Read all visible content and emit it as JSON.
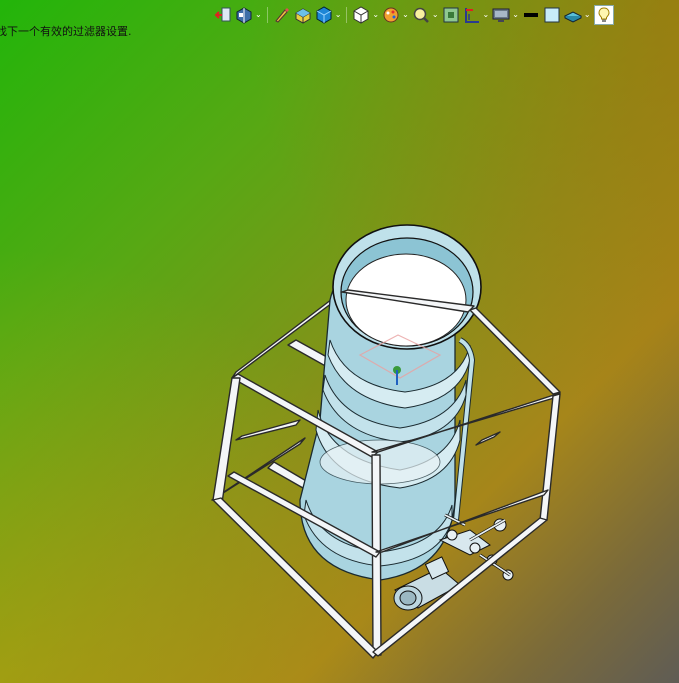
{
  "status": {
    "message": "找下一个有效的过滤器设置."
  },
  "toolbar": {
    "buttons": [
      {
        "icon": "previous-view-icon"
      },
      {
        "icon": "section-view-icon",
        "dropdown": true
      },
      {
        "icon": "pencil-sketch-icon"
      },
      {
        "icon": "dynamic-annotation-icon"
      },
      {
        "icon": "display-style-cube-icon",
        "dropdown": true
      },
      {
        "icon": "view-orientation-cube-icon",
        "dropdown": true
      },
      {
        "icon": "appearance-palette-icon",
        "dropdown": true
      },
      {
        "icon": "zoom-magnifier-icon",
        "dropdown": true
      },
      {
        "icon": "scene-icon"
      },
      {
        "icon": "hide-show-items-icon",
        "dropdown": true
      },
      {
        "icon": "monitor-display-icon",
        "dropdown": true
      },
      {
        "icon": "black-line-icon"
      },
      {
        "icon": "light-blue-square-icon"
      },
      {
        "icon": "realview-plate-icon",
        "dropdown": true
      },
      {
        "icon": "lightbulb-icon"
      }
    ]
  },
  "colors": {
    "frame": "#f4f6f8",
    "frame_edge": "#2a2a2a",
    "tank": "#a9d4e0",
    "tank_light": "#d6ecf2",
    "interior": "#ffffff"
  }
}
